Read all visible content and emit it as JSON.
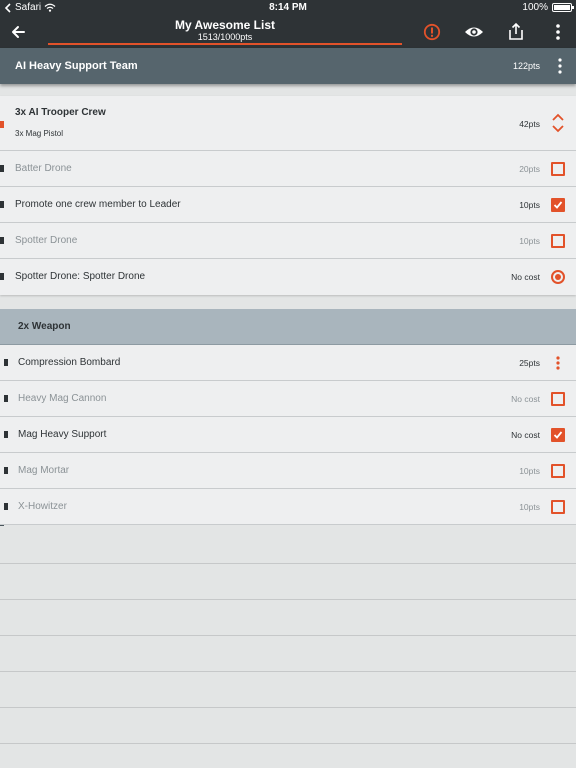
{
  "status_bar": {
    "back_app": "Safari",
    "time": "8:14 PM",
    "battery": "100%"
  },
  "app_bar": {
    "title": "My Awesome List",
    "points": "1513/1000pts",
    "icons": [
      "back-arrow-icon",
      "warning-icon",
      "eye-icon",
      "share-icon",
      "more-vert-icon"
    ]
  },
  "team": {
    "name": "AI Heavy Support Team",
    "points": "122pts"
  },
  "unit": {
    "name": "3x AI Trooper Crew",
    "sub": "3x Mag Pistol",
    "points": "42pts"
  },
  "options": [
    {
      "label": "Batter Drone",
      "points": "20pts",
      "control": "checkbox",
      "selected": false
    },
    {
      "label": "Promote one crew member to Leader",
      "points": "10pts",
      "control": "checkbox",
      "selected": true
    },
    {
      "label": "Spotter Drone",
      "points": "10pts",
      "control": "checkbox",
      "selected": false
    },
    {
      "label": "Spotter Drone: Spotter Drone",
      "points": "No cost",
      "control": "radio",
      "selected": true
    }
  ],
  "weapons": {
    "title": "2x Weapon",
    "items": [
      {
        "label": "Compression Bombard",
        "points": "25pts",
        "control": "menu",
        "selected": true
      },
      {
        "label": "Heavy Mag Cannon",
        "points": "No cost",
        "control": "checkbox",
        "selected": false
      },
      {
        "label": "Mag Heavy Support",
        "points": "No cost",
        "control": "checkbox",
        "selected": true
      },
      {
        "label": "Mag Mortar",
        "points": "10pts",
        "control": "checkbox",
        "selected": false
      },
      {
        "label": "X-Howitzer",
        "points": "10pts",
        "control": "checkbox",
        "selected": false
      }
    ]
  },
  "colors": {
    "accent": "#e2522a",
    "dark": "#2e3336",
    "header": "#56656d",
    "weapon_header": "#a9b5bd"
  }
}
